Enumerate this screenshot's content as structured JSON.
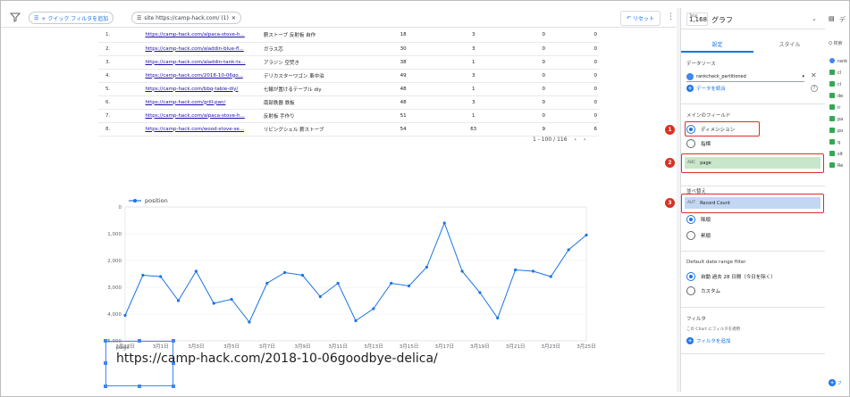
{
  "topbar": {
    "quick_filter": "+ クイック フィルタを追加",
    "site_filter": "site https://camp-hack.com/ (1)",
    "reset_label": "リセット"
  },
  "table": {
    "rows": [
      {
        "rank": "1.",
        "url": "https://camp-hack.com/alpaca-stove-h...",
        "keyword": "薪ストーブ 反射板 自作",
        "c1": "18",
        "c2": "3",
        "c3": "0",
        "c4": "0"
      },
      {
        "rank": "2.",
        "url": "https://camp-hack.com/aladdin-blue-fl...",
        "keyword": "ガラス芯",
        "c1": "30",
        "c2": "3",
        "c3": "0",
        "c4": "0"
      },
      {
        "rank": "3.",
        "url": "https://camp-hack.com/aladdin-tank-ts...",
        "keyword": "アラジン 空焚き",
        "c1": "38",
        "c2": "1",
        "c3": "0",
        "c4": "0"
      },
      {
        "rank": "4.",
        "url": "https://camp-hack.com/2018-10-06go...",
        "keyword": "デリカスターワゴン 車中泊",
        "c1": "49",
        "c2": "3",
        "c3": "0",
        "c4": "0"
      },
      {
        "rank": "5.",
        "url": "https://camp-hack.com/bbq-table-diy/",
        "keyword": "七輪が置けるテーブル diy",
        "c1": "48",
        "c2": "1",
        "c3": "0",
        "c4": "0"
      },
      {
        "rank": "6.",
        "url": "https://camp-hack.com/grill-pan/",
        "keyword": "南部鉄器 鉄板",
        "c1": "48",
        "c2": "3",
        "c3": "0",
        "c4": "0"
      },
      {
        "rank": "7.",
        "url": "https://camp-hack.com/alpaca-stove-h...",
        "keyword": "反射板 手作り",
        "c1": "51",
        "c2": "1",
        "c3": "0",
        "c4": "0"
      },
      {
        "rank": "8.",
        "url": "https://camp-hack.com/wood-stove-se...",
        "keyword": "リビングシェル 薪ストーブ",
        "c1": "54",
        "c2": "63",
        "c3": "9",
        "c4": "6"
      }
    ],
    "pager": "1 - 100 / 116"
  },
  "chart_data": {
    "type": "line",
    "legend": [
      "position"
    ],
    "legend_position": "top-left",
    "y_reversed": true,
    "ylim": [
      0,
      5000
    ],
    "yticks": [
      "0",
      "1,000",
      "2,000",
      "3,000",
      "4,000",
      "5,000"
    ],
    "xticks": [
      "2月27日",
      "3月1日",
      "3月3日",
      "3月5日",
      "3月7日",
      "3月9日",
      "3月11日",
      "3月13日",
      "3月15日",
      "3月17日",
      "3月19日",
      "3月21日",
      "3月23日",
      "3月25日"
    ],
    "color": "#1a73e8",
    "series": [
      {
        "name": "position",
        "values": [
          4050,
          2550,
          2600,
          3500,
          2400,
          3600,
          3450,
          4300,
          2850,
          2450,
          2550,
          3350,
          2850,
          4250,
          3800,
          2850,
          2950,
          2250,
          600,
          2400,
          3200,
          4150,
          2350,
          2400,
          2600,
          1600,
          1050
        ]
      }
    ]
  },
  "scorecard": {
    "label": "page",
    "value": "https://camp-hack.com/2018-10-06goodbye-delica/"
  },
  "panel": {
    "chart_type_top": "Total",
    "chart_type_value": "1,168",
    "chart_type_name": "グラフ",
    "tab_setup": "設定",
    "tab_style": "スタイル",
    "datasource_label": "データソース",
    "datasource_name": "rankcheck_partitioned",
    "blend_label": "データを統合",
    "main_field_label": "メインのフィールド",
    "option_dimension": "ディメンション",
    "option_metric": "指標",
    "dimension_tag": "ABC",
    "dimension_field": "page",
    "sort_label": "並べ替え",
    "sort_tag": "AUT",
    "sort_field": "Record Count",
    "sort_desc": "降順",
    "sort_asc": "昇順",
    "date_range_label": "Default date range filter",
    "date_auto": "自動  過去 28 日間（今日を除く）",
    "date_custom": "カスタム",
    "filter_label": "フィルタ",
    "filter_sub": "この Chart にフィルタを適用",
    "filter_add": "フィルタを追加",
    "badges": [
      "1",
      "2",
      "3"
    ]
  },
  "side_strip": {
    "search": "Q 検索",
    "items": [
      "rank",
      "cl",
      "cl",
      "de",
      "ir",
      "pa",
      "po",
      "q",
      "sit",
      "Re"
    ]
  }
}
